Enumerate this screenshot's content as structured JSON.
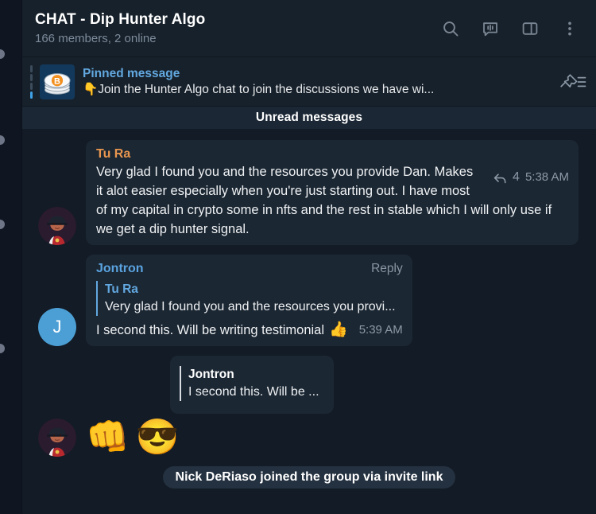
{
  "header": {
    "title": "CHAT - Dip Hunter Algo",
    "subtitle": "166 members, 2 online",
    "icons": {
      "search": "search-icon",
      "voice_chat": "voice-chat-icon",
      "panel": "panel-toggle-icon",
      "more": "more-options-icon"
    }
  },
  "pinned": {
    "label": "Pinned message",
    "snippet": "👇Join the Hunter Algo chat to join the discussions we have wi...",
    "thumbnail": "bitcoin-coin-stack-image",
    "action_icon": "pin-list-icon",
    "steps_total": 4,
    "active_step": 4
  },
  "divider": {
    "unread_label": "Unread messages"
  },
  "messages": [
    {
      "sender": "Tu Ra",
      "sender_color": "#e8964f",
      "avatar": "pixel-art-avatar",
      "text": "Very glad I found you and the resources you provide Dan. Makes it alot easier especially when you're just starting out. I have most of my capital in crypto some in nfts and the rest in stable which I will only use if we get a dip hunter signal.",
      "reply_count": "4",
      "time": "5:38 AM"
    },
    {
      "sender": "Jontron",
      "sender_color": "#5aa3e0",
      "avatar_letter": "J",
      "reply_label": "Reply",
      "quote": {
        "name": "Tu Ra",
        "text": "Very glad I found you and the resources you provi..."
      },
      "text": "I second this. Will be writing testimonial",
      "emoji": "👍",
      "time": "5:39 AM"
    },
    {
      "avatar": "pixel-art-avatar",
      "quote": {
        "name": "Jontron",
        "text": "I second this. Will be ..."
      },
      "reactions": [
        "👊",
        "😎"
      ]
    }
  ],
  "service_message": {
    "text": "Nick DeRiaso joined the group via invite link"
  },
  "colors": {
    "page_bg": "#131b26",
    "header_bg": "#17212b",
    "bubble_bg": "#1b2733",
    "accent_blue": "#62a8e0",
    "accent_orange": "#e8964f",
    "unread_bar": "#1b2735"
  }
}
